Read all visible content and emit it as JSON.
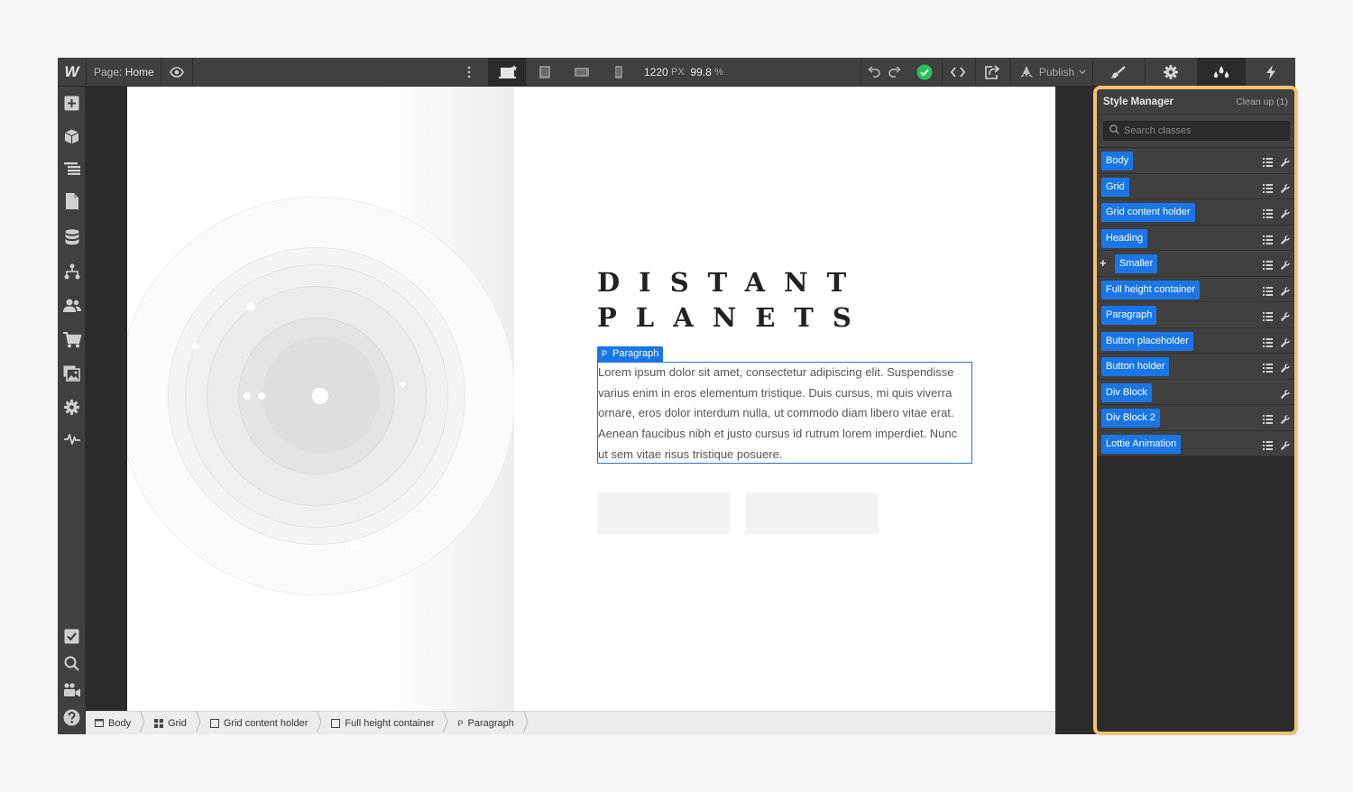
{
  "topbar": {
    "logo": "W",
    "page_label": "Page:",
    "page_name": "Home",
    "canvas_width": "1220",
    "canvas_unit": "PX",
    "zoom": "99.8",
    "zoom_unit": "%",
    "publish_label": "Publish",
    "status_color": "#23c25a"
  },
  "canvas": {
    "heading_line1": "DISTANT",
    "heading_line2": "PLANETS",
    "paragraph_tag": "Paragraph",
    "paragraph_tag_icon": "P",
    "paragraph_text": "Lorem ipsum dolor sit amet, consectetur adipiscing elit. Suspendisse varius enim in eros elementum tristique. Duis cursus, mi quis viverra ornare, eros dolor interdum nulla, ut commodo diam libero vitae erat. Aenean faucibus nibh et justo cursus id rutrum lorem imperdiet. Nunc ut sem vitae risus tristique posuere."
  },
  "breadcrumb": [
    {
      "label": "Body",
      "icon": "body-icon"
    },
    {
      "label": "Grid",
      "icon": "grid-icon"
    },
    {
      "label": "Grid content holder",
      "icon": "square-icon"
    },
    {
      "label": "Full height container",
      "icon": "square-icon"
    },
    {
      "label": "Paragraph",
      "icon": "paragraph-icon",
      "icon_text": "P"
    }
  ],
  "style_manager": {
    "title": "Style Manager",
    "cleanup": "Clean up (1)",
    "search_placeholder": "Search classes",
    "classes": [
      {
        "label": "Body",
        "has_list": true
      },
      {
        "label": "Grid",
        "has_list": true
      },
      {
        "label": "Grid content holder",
        "has_list": true
      },
      {
        "label": "Heading",
        "has_list": true
      },
      {
        "label": "Smaller",
        "has_list": true,
        "combo": true
      },
      {
        "label": "Full height container",
        "has_list": true
      },
      {
        "label": "Paragraph",
        "has_list": true
      },
      {
        "label": "Button placeholder",
        "has_list": true
      },
      {
        "label": "Button holder",
        "has_list": true
      },
      {
        "label": "Div Block",
        "has_list": false
      },
      {
        "label": "Div Block 2",
        "has_list": true
      },
      {
        "label": "Lottie Animation",
        "has_list": true
      }
    ]
  },
  "colors": {
    "accent": "#1a76e6",
    "highlight_border": "#f6c26f"
  }
}
